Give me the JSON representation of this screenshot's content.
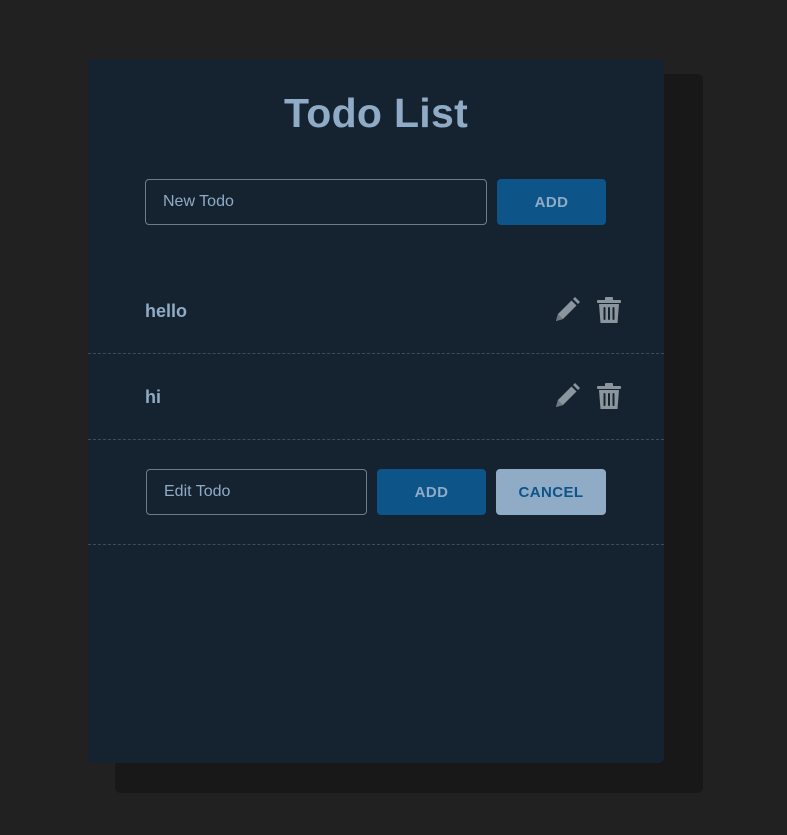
{
  "app": {
    "title": "Todo List"
  },
  "new_todo": {
    "placeholder": "New Todo",
    "add_label": "ADD"
  },
  "todos": [
    {
      "text": "hello",
      "edit_icon": "pencil-icon",
      "delete_icon": "trash-icon"
    },
    {
      "text": "hi",
      "edit_icon": "pencil-icon",
      "delete_icon": "trash-icon"
    }
  ],
  "edit_todo": {
    "placeholder": "Edit Todo",
    "add_label": "ADD",
    "cancel_label": "CANCEL"
  },
  "colors": {
    "background": "#212121",
    "card": "#152330",
    "accent": "#8fabc6",
    "primary_button": "#0d5489",
    "icon": "#8b959e"
  }
}
